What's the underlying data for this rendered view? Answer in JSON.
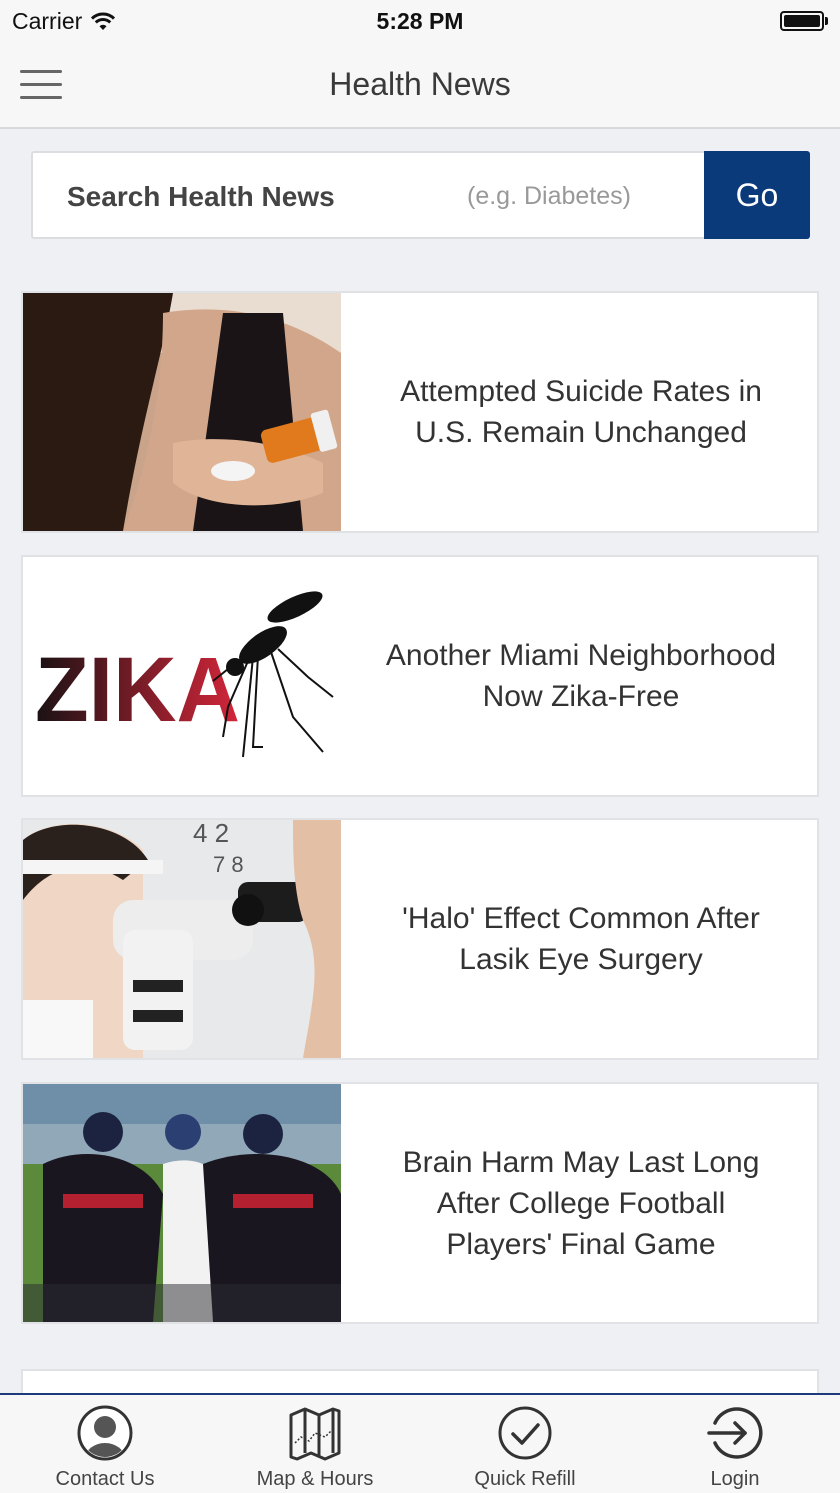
{
  "status_bar": {
    "carrier": "Carrier",
    "time": "5:28 PM"
  },
  "nav": {
    "title": "Health News",
    "menu_icon": "hamburger-menu-icon"
  },
  "search": {
    "label": "Search Health News",
    "hint": "(e.g. Diabetes)",
    "go_label": "Go"
  },
  "articles": [
    {
      "title": "Attempted Suicide Rates in U.S. Remain Unchanged",
      "image": "woman-with-pills-photo"
    },
    {
      "title": "Another Miami Neighborhood Now Zika-Free",
      "image": "zika-mosquito-logo",
      "logo_text": "ZIKA"
    },
    {
      "title": "'Halo' Effect Common After Lasik Eye Surgery",
      "image": "eye-exam-photo"
    },
    {
      "title": "Brain Harm May Last Long After College Football Players' Final Game",
      "image": "football-players-photo"
    }
  ],
  "tab_bar": [
    {
      "label": "Contact Us",
      "icon": "person-icon"
    },
    {
      "label": "Map & Hours",
      "icon": "map-icon"
    },
    {
      "label": "Quick Refill",
      "icon": "checkmark-circle-icon"
    },
    {
      "label": "Login",
      "icon": "login-arrow-icon"
    }
  ],
  "colors": {
    "accent": "#0b3a7a",
    "background": "#eff0f3",
    "bar": "#f7f7f7"
  }
}
